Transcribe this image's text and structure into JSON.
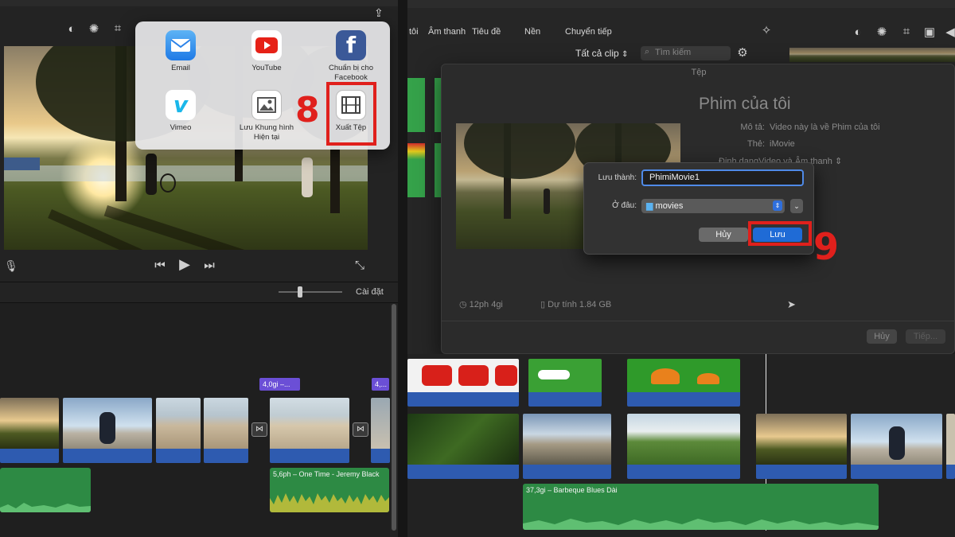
{
  "left": {
    "timeline_settings": "Cài đặt",
    "share": {
      "apps": [
        {
          "label": "Email"
        },
        {
          "label": "YouTube"
        },
        {
          "label": "Chuẩn bị cho Facebook"
        },
        {
          "label": "Vimeo"
        },
        {
          "label": "Lưu Khung hình Hiện tại"
        },
        {
          "label": "Xuất Tệp"
        }
      ],
      "step_number": "8"
    },
    "timeline": {
      "title_badge_1": "4,0gi –...",
      "title_badge_2": "4,...",
      "audio_label": "5,6ph – One Time - Jeremy Black"
    }
  },
  "right": {
    "tabs": [
      "tôi",
      "Âm thanh",
      "Tiêu đề",
      "Nền",
      "Chuyển tiếp"
    ],
    "clip_filter": "Tất cả clip",
    "search_placeholder": "Tìm kiếm",
    "dialog": {
      "window_title": "Tệp",
      "movie_title": "Phim của tôi",
      "desc_label": "Mô tả:",
      "desc_value": "Video này là về Phim của tôi",
      "tags_label": "Thẻ:",
      "tags_value": "iMovie",
      "format_label": "Định dạng",
      "format_value": "Video và Âm thanh",
      "duration": "12ph 4gi",
      "estimate": "Dự tính 1.84 GB",
      "cancel": "Hủy",
      "next": "Tiếp..."
    },
    "save_sheet": {
      "save_as_label": "Lưu thành:",
      "save_as_value": "PhimiMovie1",
      "where_label": "Ở đâu:",
      "where_value": "movies",
      "cancel": "Hủy",
      "save": "Lưu"
    },
    "step_number": "9",
    "timeline": {
      "audio_label": "37,3gi – Barbeque Blues Dài"
    }
  },
  "colors": {
    "accent_red": "#e0201c",
    "save_blue": "#1f6bd6",
    "clip_blue": "#2e5bb0",
    "audio_green": "#2d8a44",
    "title_purple": "#6b4fd6"
  }
}
